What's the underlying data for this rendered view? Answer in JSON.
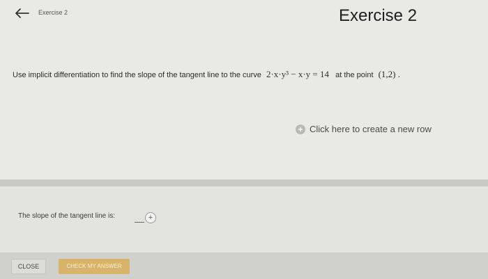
{
  "header": {
    "breadcrumb": "Exercise 2",
    "title": "Exercise 2",
    "back_icon": "arrow-left-icon"
  },
  "question": {
    "prefix": "Use implicit differentiation to find the slope of the tangent line to the curve",
    "equation": "2·x·y³ − x·y = 14",
    "middle": "at the point",
    "point": "(1,2) ."
  },
  "new_row": {
    "icon": "plus-circle-icon",
    "label": "Click here to create a new row"
  },
  "answer": {
    "label": "The slope of the tangent line is:",
    "value": "",
    "add_icon": "plus-icon",
    "add_symbol": "+"
  },
  "footer": {
    "close_label": "CLOSE",
    "check_label": "CHECK MY ANSWER"
  },
  "colors": {
    "check_button": "#d8b46a",
    "background": "#e9e9e6"
  }
}
